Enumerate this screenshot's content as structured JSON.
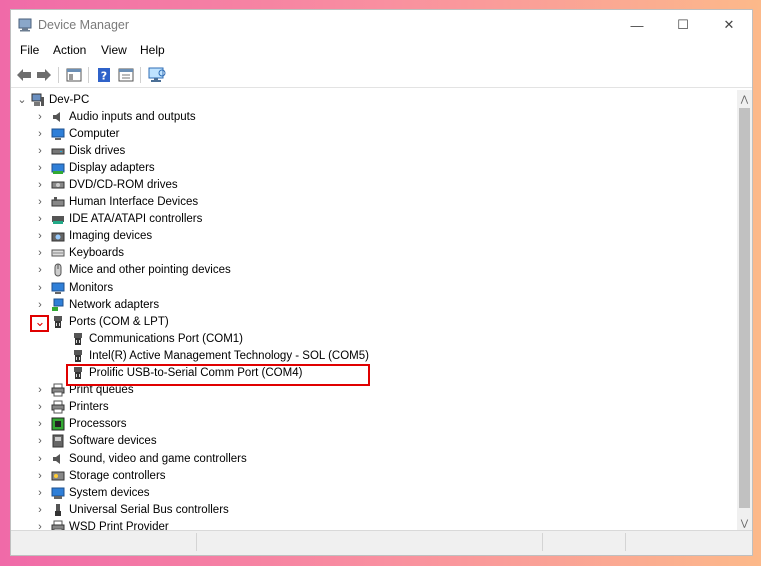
{
  "window": {
    "title": "Device Manager"
  },
  "controls": {
    "minimize": "—",
    "maximize": "☐",
    "close": "✕"
  },
  "menu": [
    "File",
    "Action",
    "View",
    "Help"
  ],
  "tree": {
    "root": "Dev-PC",
    "categories": [
      {
        "label": "Audio inputs and outputs",
        "icon": "speaker-icon"
      },
      {
        "label": "Computer",
        "icon": "computer-icon"
      },
      {
        "label": "Disk drives",
        "icon": "disk-drive-icon"
      },
      {
        "label": "Display adapters",
        "icon": "display-adapter-icon"
      },
      {
        "label": "DVD/CD-ROM drives",
        "icon": "dvd-icon"
      },
      {
        "label": "Human Interface Devices",
        "icon": "hid-icon"
      },
      {
        "label": "IDE ATA/ATAPI controllers",
        "icon": "ide-controller-icon"
      },
      {
        "label": "Imaging devices",
        "icon": "camera-icon"
      },
      {
        "label": "Keyboards",
        "icon": "keyboard-icon"
      },
      {
        "label": "Mice and other pointing devices",
        "icon": "mouse-icon"
      },
      {
        "label": "Monitors",
        "icon": "monitor-icon"
      },
      {
        "label": "Network adapters",
        "icon": "network-icon"
      },
      {
        "label": "Ports (COM & LPT)",
        "icon": "port-icon",
        "expanded": true
      },
      {
        "label": "Print queues",
        "icon": "printer-icon"
      },
      {
        "label": "Printers",
        "icon": "printer-icon"
      },
      {
        "label": "Processors",
        "icon": "processor-icon"
      },
      {
        "label": "Software devices",
        "icon": "software-device-icon"
      },
      {
        "label": "Sound, video and game controllers",
        "icon": "sound-icon"
      },
      {
        "label": "Storage controllers",
        "icon": "storage-icon"
      },
      {
        "label": "System devices",
        "icon": "system-icon"
      },
      {
        "label": "Universal Serial Bus controllers",
        "icon": "usb-icon"
      },
      {
        "label": "WSD Print Provider",
        "icon": "printer-icon"
      }
    ],
    "ports_children": [
      "Communications Port (COM1)",
      "Intel(R) Active Management Technology - SOL (COM5)",
      "Prolific USB-to-Serial Comm Port (COM4)"
    ]
  },
  "colors": {
    "highlight": "#e00000",
    "accent_blue": "#2f7fd8"
  }
}
